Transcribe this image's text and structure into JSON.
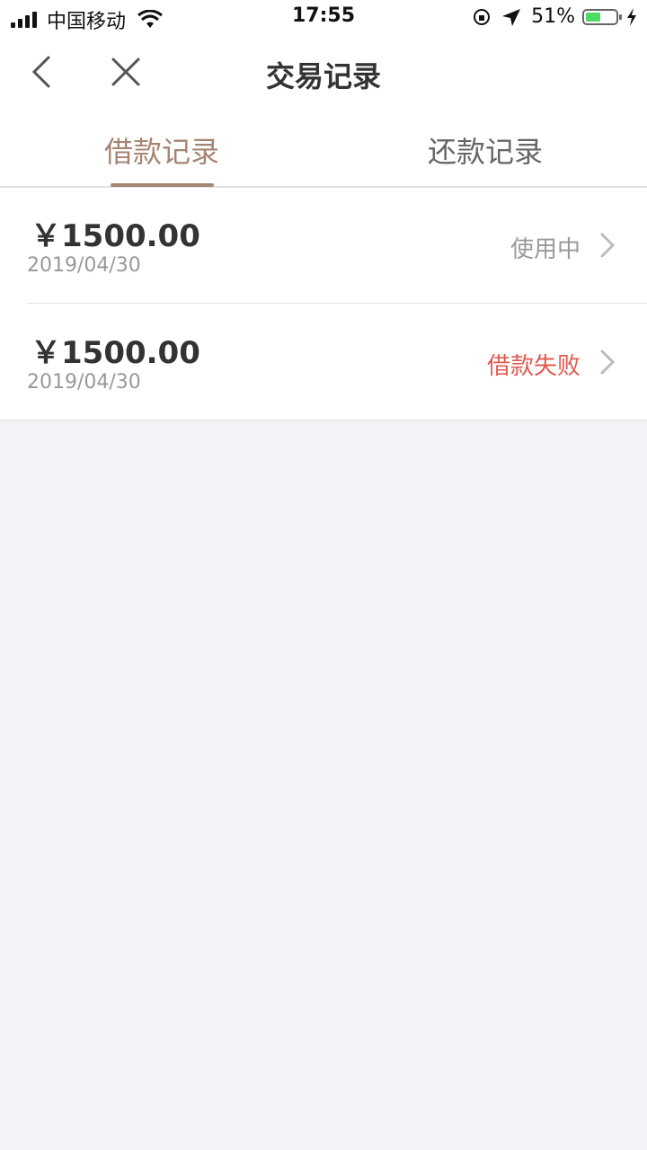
{
  "status_bar": {
    "carrier": "中国移动",
    "time": "17:55",
    "battery_percent": "51%",
    "battery_level": 0.51
  },
  "nav": {
    "title": "交易记录"
  },
  "tabs": [
    {
      "label": "借款记录",
      "active": true
    },
    {
      "label": "还款记录",
      "active": false
    }
  ],
  "records": [
    {
      "amount": "￥1500.00",
      "date": "2019/04/30",
      "status": "使用中"
    },
    {
      "amount": "￥1500.00",
      "date": "2019/04/30",
      "status": "借款失败"
    }
  ],
  "colors": {
    "accent": "#a58473",
    "fail": "#e05a4e",
    "background": "#f2f2f7"
  }
}
